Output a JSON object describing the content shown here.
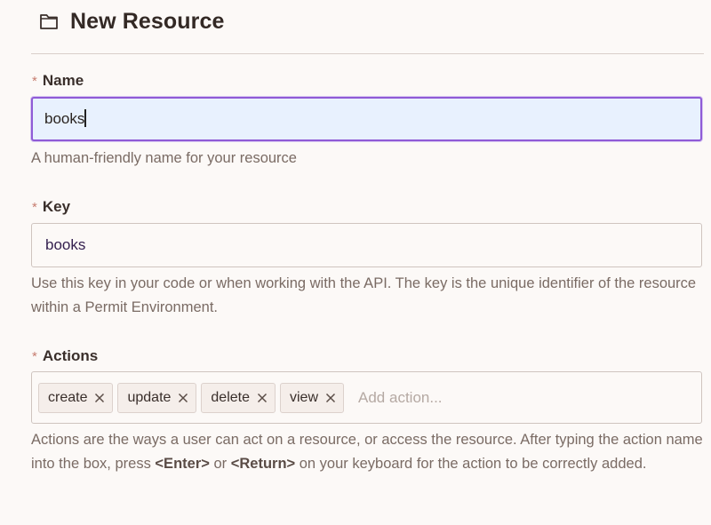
{
  "header": {
    "title": "New Resource",
    "icon": "folder-icon"
  },
  "name_field": {
    "label": "Name",
    "required_mark": "*",
    "value": "books",
    "help": "A human-friendly name for your resource"
  },
  "key_field": {
    "label": "Key",
    "required_mark": "*",
    "value": "books",
    "help": "Use this key in your code or when working with the API. The key is the unique identifier of the resource within a Permit Environment."
  },
  "actions_field": {
    "label": "Actions",
    "required_mark": "*",
    "chips": [
      "create",
      "update",
      "delete",
      "view"
    ],
    "placeholder": "Add action...",
    "help": {
      "part1": "Actions are the ways a user can act on a resource, or access the resource. After typing the action name into the box, press ",
      "enter": "<Enter>",
      "or": " or ",
      "return": "<Return>",
      "part2": " on your keyboard for the action to be correctly added."
    }
  },
  "colors": {
    "accent": "#8f5bd6",
    "focus_bg": "#e8f1fe",
    "required": "#c77d70"
  }
}
